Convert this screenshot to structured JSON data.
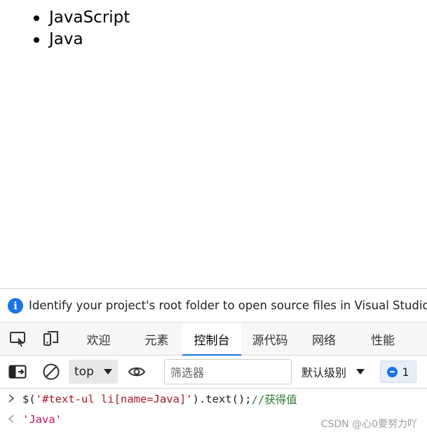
{
  "page": {
    "list_items": [
      "JavaScript",
      "Java"
    ]
  },
  "infobar": {
    "icon": "info-icon",
    "text": "Identify your project's root folder to open source files in Visual Studio C"
  },
  "tabs": {
    "inspect_icon": "inspect-icon",
    "device_icon": "device-toolbar-icon",
    "items": [
      "欢迎",
      "元素",
      "控制台",
      "源代码",
      "网络",
      "性能"
    ],
    "active": "控制台"
  },
  "toolbar": {
    "sidebar_icon": "sidebar-toggle-icon",
    "clear_icon": "clear-console-icon",
    "context": "top",
    "eye_icon": "live-expression-icon",
    "filter_placeholder": "筛选器",
    "levels_label": "默认级别",
    "issues_count": "1"
  },
  "console": {
    "input_code": "$(",
    "input_string": "'#text-ul li[name=Java]'",
    "input_tail": ").text();",
    "input_comment": "//获得值",
    "result": "'Java'"
  },
  "watermark": "CSDN @心0要努力吖",
  "colors": {
    "accent": "#1a73e8",
    "string": "#a6192e",
    "comment": "#2e7d32",
    "result": "#c2185b"
  }
}
